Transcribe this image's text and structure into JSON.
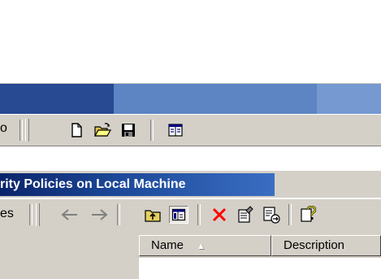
{
  "window": {
    "inner_title": "rity Policies on Local Machine"
  },
  "toolbar_top": {
    "left_partial_text": "o",
    "buttons": [
      {
        "name": "new-icon"
      },
      {
        "name": "open-folder-icon"
      },
      {
        "name": "save-icon"
      },
      {
        "name": "details-view-icon"
      }
    ]
  },
  "toolbar_inner": {
    "left_partial_text": "es",
    "buttons": [
      {
        "name": "back-arrow-icon"
      },
      {
        "name": "forward-arrow-icon"
      },
      {
        "name": "up-one-level-icon"
      },
      {
        "name": "show-hide-tree-icon",
        "pressed": true
      },
      {
        "name": "delete-icon"
      },
      {
        "name": "properties-icon"
      },
      {
        "name": "export-list-icon"
      },
      {
        "name": "help-icon"
      }
    ]
  },
  "list": {
    "columns": [
      {
        "label": "Name",
        "sorted": "ascending"
      },
      {
        "label": "Description"
      }
    ]
  },
  "colors": {
    "title_dark": "#0a246a",
    "title_light": "#3a6ec2",
    "face": "#d4d0c8",
    "delete_red": "#ff0000"
  }
}
